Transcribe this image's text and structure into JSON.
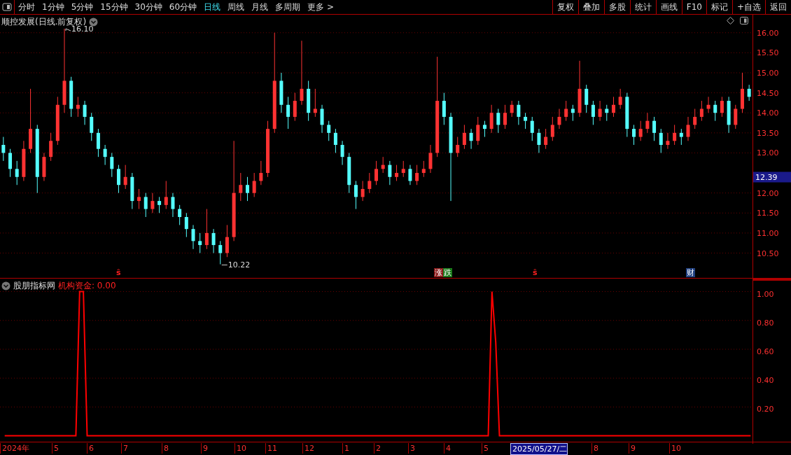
{
  "toolbar": {
    "tabs": [
      {
        "label": "分时",
        "selected": false
      },
      {
        "label": "1分钟",
        "selected": false
      },
      {
        "label": "5分钟",
        "selected": false
      },
      {
        "label": "15分钟",
        "selected": false
      },
      {
        "label": "30分钟",
        "selected": false
      },
      {
        "label": "60分钟",
        "selected": false
      },
      {
        "label": "日线",
        "selected": true
      },
      {
        "label": "周线",
        "selected": false
      },
      {
        "label": "月线",
        "selected": false
      },
      {
        "label": "多周期",
        "selected": false
      },
      {
        "label": "更多 >",
        "selected": false
      }
    ],
    "buttons": [
      "复权",
      "叠加",
      "多股",
      "统计",
      "画线",
      "F10",
      "标记",
      "+自选",
      "返回"
    ]
  },
  "main_chart": {
    "title": "顺控发展(日线.前复权)",
    "high_label": "16.10",
    "low_label": "10.22",
    "price_tag": "12.39",
    "markers": [
      {
        "kind": "symbol",
        "text": "ŝ"
      },
      {
        "kind": "badge",
        "text": "涨",
        "color": "#8b1a1a"
      },
      {
        "kind": "badge",
        "text": "跌",
        "color": "#1a7a1a"
      },
      {
        "kind": "symbol",
        "text": "ŝ"
      },
      {
        "kind": "badge",
        "text": "财",
        "color": "#1f3f7f"
      }
    ],
    "chart_data": {
      "type": "candlestick",
      "grid": true,
      "ylim": [
        9.88,
        16.45
      ],
      "yticks": [
        {
          "value": 16,
          "label": "16.00"
        },
        {
          "value": 15.5,
          "label": "15.50"
        },
        {
          "value": 15,
          "label": "15.00"
        },
        {
          "value": 14.5,
          "label": "14.50"
        },
        {
          "value": 14,
          "label": "14.00"
        },
        {
          "value": 13.5,
          "label": "13.50"
        },
        {
          "value": 13,
          "label": "13.00"
        },
        {
          "value": 12,
          "label": "12.00"
        },
        {
          "value": 11.5,
          "label": "11.50"
        },
        {
          "value": 11,
          "label": "11.00"
        },
        {
          "value": 10.5,
          "label": "10.50"
        }
      ],
      "categories": [
        null,
        null,
        null,
        null,
        null,
        null,
        null,
        null,
        null,
        null,
        null,
        null,
        null,
        null,
        null,
        null,
        null,
        null,
        null,
        null,
        null,
        null,
        null,
        null,
        null,
        null,
        null,
        null,
        null,
        null,
        null,
        null,
        null,
        null,
        null,
        null,
        null,
        null,
        null,
        null,
        null,
        null,
        null,
        null,
        null,
        null,
        null,
        null,
        null,
        null,
        null,
        null,
        null,
        null,
        null,
        null,
        null,
        null,
        null,
        null,
        null,
        null,
        null,
        null,
        null,
        null,
        null,
        null,
        null,
        null,
        null,
        null,
        null,
        null,
        null,
        null,
        null,
        null,
        null,
        null,
        null,
        null,
        null,
        null,
        null,
        null,
        null,
        null,
        null,
        null,
        null,
        null,
        null,
        null,
        null,
        null,
        null,
        null,
        null,
        null,
        null,
        null,
        null,
        null,
        null,
        null,
        null,
        null,
        null,
        null,
        null
      ],
      "ohlc": [
        [
          13.2,
          13.4,
          12.8,
          13.0
        ],
        [
          13.0,
          13.1,
          12.4,
          12.6
        ],
        [
          12.6,
          12.8,
          12.2,
          12.4
        ],
        [
          12.4,
          13.3,
          12.3,
          13.1
        ],
        [
          13.1,
          14.6,
          13.0,
          13.6
        ],
        [
          13.6,
          13.7,
          12.0,
          12.4
        ],
        [
          12.4,
          13.0,
          12.3,
          12.9
        ],
        [
          12.9,
          13.5,
          12.8,
          13.3
        ],
        [
          13.3,
          14.4,
          13.2,
          14.2
        ],
        [
          14.2,
          16.1,
          14.0,
          14.8
        ],
        [
          14.8,
          14.9,
          13.9,
          14.1
        ],
        [
          14.1,
          14.4,
          13.9,
          14.2
        ],
        [
          14.2,
          14.3,
          13.7,
          13.9
        ],
        [
          13.9,
          14.0,
          13.3,
          13.5
        ],
        [
          13.5,
          13.6,
          12.9,
          13.1
        ],
        [
          13.1,
          13.2,
          12.7,
          12.9
        ],
        [
          12.9,
          13.0,
          12.4,
          12.6
        ],
        [
          12.6,
          12.7,
          12.0,
          12.2
        ],
        [
          12.2,
          12.7,
          12.1,
          12.4
        ],
        [
          12.4,
          12.5,
          11.6,
          11.8
        ],
        [
          11.8,
          12.1,
          11.6,
          11.9
        ],
        [
          11.9,
          12.0,
          11.4,
          11.6
        ],
        [
          11.6,
          12.0,
          11.5,
          11.8
        ],
        [
          11.8,
          11.9,
          11.5,
          11.7
        ],
        [
          11.7,
          12.3,
          11.6,
          11.9
        ],
        [
          11.9,
          12.0,
          11.4,
          11.6
        ],
        [
          11.6,
          11.7,
          11.2,
          11.4
        ],
        [
          11.4,
          11.5,
          10.9,
          11.1
        ],
        [
          11.1,
          11.2,
          10.6,
          10.8
        ],
        [
          10.8,
          11.0,
          10.5,
          10.7
        ],
        [
          10.7,
          11.6,
          10.6,
          11.0
        ],
        [
          11.0,
          11.1,
          10.5,
          10.7
        ],
        [
          10.7,
          10.8,
          10.22,
          10.5
        ],
        [
          10.5,
          11.2,
          10.4,
          10.9
        ],
        [
          10.9,
          13.3,
          10.8,
          12.0
        ],
        [
          12.0,
          12.5,
          11.8,
          12.2
        ],
        [
          12.2,
          12.4,
          11.8,
          12.0
        ],
        [
          12.0,
          12.5,
          11.9,
          12.3
        ],
        [
          12.3,
          12.8,
          12.2,
          12.5
        ],
        [
          12.5,
          13.8,
          12.4,
          13.6
        ],
        [
          13.6,
          16.0,
          13.5,
          14.8
        ],
        [
          14.8,
          15.0,
          14.0,
          14.2
        ],
        [
          14.2,
          14.4,
          13.6,
          13.9
        ],
        [
          13.9,
          14.5,
          13.8,
          14.3
        ],
        [
          14.3,
          15.8,
          14.2,
          14.6
        ],
        [
          14.6,
          14.8,
          13.8,
          14.0
        ],
        [
          14.0,
          14.6,
          13.9,
          14.1
        ],
        [
          14.1,
          14.2,
          13.5,
          13.7
        ],
        [
          13.7,
          13.8,
          13.3,
          13.5
        ],
        [
          13.5,
          13.6,
          13.0,
          13.2
        ],
        [
          13.2,
          13.3,
          12.7,
          12.9
        ],
        [
          12.9,
          13.0,
          12.0,
          12.2
        ],
        [
          12.2,
          12.3,
          11.6,
          11.9
        ],
        [
          11.9,
          12.3,
          11.8,
          12.1
        ],
        [
          12.1,
          12.5,
          12.0,
          12.3
        ],
        [
          12.3,
          12.8,
          12.2,
          12.6
        ],
        [
          12.6,
          12.9,
          12.5,
          12.7
        ],
        [
          12.7,
          12.8,
          12.2,
          12.4
        ],
        [
          12.4,
          12.7,
          12.3,
          12.5
        ],
        [
          12.5,
          12.8,
          12.4,
          12.6
        ],
        [
          12.6,
          12.7,
          12.2,
          12.3
        ],
        [
          12.3,
          12.7,
          12.2,
          12.5
        ],
        [
          12.5,
          12.8,
          12.4,
          12.6
        ],
        [
          12.6,
          13.2,
          12.5,
          13.0
        ],
        [
          13.0,
          15.4,
          12.9,
          14.3
        ],
        [
          14.3,
          14.5,
          13.7,
          13.9
        ],
        [
          13.9,
          14.0,
          11.8,
          13.0
        ],
        [
          13.0,
          13.4,
          12.9,
          13.2
        ],
        [
          13.2,
          13.7,
          13.1,
          13.5
        ],
        [
          13.5,
          13.6,
          13.1,
          13.3
        ],
        [
          13.3,
          13.9,
          13.2,
          13.7
        ],
        [
          13.7,
          13.8,
          13.4,
          13.6
        ],
        [
          13.6,
          14.2,
          13.5,
          14.0
        ],
        [
          14.0,
          14.1,
          13.5,
          13.7
        ],
        [
          13.7,
          14.2,
          13.6,
          14.0
        ],
        [
          14.0,
          14.3,
          13.9,
          14.2
        ],
        [
          14.2,
          14.3,
          13.7,
          13.9
        ],
        [
          13.9,
          14.0,
          13.6,
          13.8
        ],
        [
          13.8,
          13.9,
          13.3,
          13.5
        ],
        [
          13.5,
          13.6,
          13.0,
          13.2
        ],
        [
          13.2,
          13.6,
          13.1,
          13.4
        ],
        [
          13.4,
          13.9,
          13.3,
          13.7
        ],
        [
          13.7,
          14.1,
          13.6,
          13.9
        ],
        [
          13.9,
          14.3,
          13.8,
          14.1
        ],
        [
          14.1,
          14.2,
          13.8,
          14.0
        ],
        [
          14.0,
          15.3,
          13.9,
          14.6
        ],
        [
          14.6,
          14.7,
          14.0,
          14.2
        ],
        [
          14.2,
          14.3,
          13.7,
          13.9
        ],
        [
          13.9,
          14.3,
          13.8,
          14.1
        ],
        [
          14.1,
          14.2,
          13.8,
          14.0
        ],
        [
          14.0,
          14.4,
          13.9,
          14.2
        ],
        [
          14.2,
          14.6,
          14.1,
          14.4
        ],
        [
          14.4,
          14.5,
          13.4,
          13.6
        ],
        [
          13.6,
          13.7,
          13.2,
          13.4
        ],
        [
          13.4,
          13.8,
          13.3,
          13.6
        ],
        [
          13.6,
          14.0,
          13.5,
          13.8
        ],
        [
          13.8,
          13.9,
          13.3,
          13.5
        ],
        [
          13.5,
          13.6,
          13.0,
          13.2
        ],
        [
          13.2,
          13.5,
          13.1,
          13.3
        ],
        [
          13.3,
          13.7,
          13.2,
          13.5
        ],
        [
          13.5,
          13.6,
          13.2,
          13.4
        ],
        [
          13.4,
          13.9,
          13.3,
          13.7
        ],
        [
          13.7,
          14.1,
          13.6,
          13.9
        ],
        [
          13.9,
          14.3,
          13.8,
          14.1
        ],
        [
          14.1,
          14.4,
          14.0,
          14.2
        ],
        [
          14.2,
          14.3,
          13.8,
          14.0
        ],
        [
          14.0,
          14.4,
          13.9,
          14.3
        ],
        [
          14.3,
          14.4,
          13.5,
          13.7
        ],
        [
          13.7,
          14.2,
          13.6,
          14.1
        ],
        [
          14.1,
          15.0,
          14.0,
          14.6
        ],
        [
          14.6,
          14.7,
          14.3,
          14.4
        ]
      ]
    }
  },
  "indicator": {
    "name": "股朋指标网",
    "reading": "机构资金: 0.00",
    "chart_data": {
      "type": "line",
      "grid": true,
      "categories": [
        null,
        null,
        null,
        null,
        null,
        null,
        null,
        null,
        null,
        null,
        null,
        null,
        null,
        null,
        null,
        null,
        null,
        null,
        null,
        null,
        null,
        null,
        null,
        null,
        null,
        null,
        null,
        null,
        null,
        null,
        null,
        null,
        null,
        null,
        null,
        null,
        null,
        null,
        null,
        null,
        null,
        null,
        null,
        null,
        null,
        null,
        null,
        null,
        null,
        null,
        null,
        null,
        null,
        null,
        null,
        null,
        null,
        null,
        null,
        null,
        null,
        null,
        null,
        null,
        null,
        null,
        null,
        null,
        null,
        null,
        null,
        null,
        null,
        null,
        null,
        null,
        null,
        null,
        null,
        null,
        null,
        null,
        null,
        null,
        null,
        null,
        null,
        null,
        null,
        null,
        null,
        null,
        null,
        null,
        null,
        null,
        null,
        null,
        null,
        null,
        null,
        null,
        null,
        null,
        null,
        null,
        null,
        null,
        null,
        null,
        null,
        null,
        null,
        null,
        null,
        null,
        null,
        null,
        null,
        null,
        null,
        null,
        null,
        null,
        null,
        null,
        null,
        null,
        null,
        null,
        null,
        null,
        null,
        null,
        null,
        null,
        null,
        null,
        null,
        null,
        null,
        null,
        null,
        null,
        null,
        null,
        null,
        null,
        null,
        null,
        null,
        null,
        null,
        null,
        null,
        null,
        null,
        null,
        null,
        null,
        null,
        null,
        null,
        null,
        null,
        null,
        null,
        null,
        null,
        null,
        null,
        null,
        null,
        null,
        null,
        null,
        null,
        null,
        null,
        null,
        null,
        null,
        null,
        null,
        null,
        null,
        null,
        null,
        null,
        null,
        null,
        null,
        null,
        null,
        null,
        null,
        null,
        null,
        null,
        null
      ],
      "ylim": [
        -0.06,
        1.09
      ],
      "yticks": [
        {
          "value": 1,
          "label": "1.00"
        },
        {
          "value": 0.8,
          "label": "0.80"
        },
        {
          "value": 0.6,
          "label": "0.60"
        },
        {
          "value": 0.4,
          "label": "0.40"
        },
        {
          "value": 0.2,
          "label": "0.20"
        }
      ],
      "series": [
        {
          "color": "#ff0000",
          "values": [
            0,
            0,
            0,
            0,
            0,
            0,
            0,
            0,
            0,
            0,
            0,
            0,
            0,
            0,
            0,
            0,
            0,
            0,
            0,
            0,
            1,
            1,
            0,
            0,
            0,
            0,
            0,
            0,
            0,
            0,
            0,
            0,
            0,
            0,
            0,
            0,
            0,
            0,
            0,
            0,
            0,
            0,
            0,
            0,
            0,
            0,
            0,
            0,
            0,
            0,
            0,
            0,
            0,
            0,
            0,
            0,
            0,
            0,
            0,
            0,
            0,
            0,
            0,
            0,
            0,
            0,
            0,
            0,
            0,
            0,
            0,
            0,
            0,
            0,
            0,
            0,
            0,
            0,
            0,
            0,
            0,
            0,
            0,
            0,
            0,
            0,
            0,
            0,
            0,
            0,
            0,
            0,
            0,
            0,
            0,
            0,
            0,
            0,
            0,
            0,
            0,
            0,
            0,
            0,
            0,
            0,
            0,
            0,
            0,
            0,
            0,
            0,
            0,
            0,
            0,
            0,
            0,
            0,
            0,
            0,
            0,
            0,
            0,
            0,
            0,
            0,
            0,
            0,
            0,
            0,
            1,
            0.65,
            0,
            0,
            0,
            0,
            0,
            0,
            0,
            0,
            0,
            0,
            0,
            0,
            0,
            0,
            0,
            0,
            0,
            0,
            0,
            0,
            0,
            0,
            0,
            0,
            0,
            0,
            0,
            0,
            0,
            0,
            0,
            0,
            0,
            0,
            0,
            0,
            0,
            0,
            0,
            0,
            0,
            0,
            0,
            0,
            0,
            0,
            0,
            0,
            0,
            0,
            0,
            0,
            0,
            0,
            0,
            0,
            0,
            0,
            0,
            0,
            0,
            0,
            0,
            0,
            0,
            0,
            0,
            0
          ]
        }
      ]
    }
  },
  "time_axis": {
    "labels": [
      {
        "text": "2024年",
        "selected": false
      },
      {
        "text": "5",
        "selected": false
      },
      {
        "text": "6",
        "selected": false
      },
      {
        "text": "7",
        "selected": false
      },
      {
        "text": "8",
        "selected": false
      },
      {
        "text": "9",
        "selected": false
      },
      {
        "text": "10",
        "selected": false
      },
      {
        "text": "11",
        "selected": false
      },
      {
        "text": "12",
        "selected": false
      },
      {
        "text": "1",
        "selected": false
      },
      {
        "text": "2",
        "selected": false
      },
      {
        "text": "3",
        "selected": false
      },
      {
        "text": "4",
        "selected": false
      },
      {
        "text": "5",
        "selected": false
      },
      {
        "text": "2025/05/27/二",
        "selected": true
      },
      {
        "text": "8",
        "selected": false
      },
      {
        "text": "9",
        "selected": false
      },
      {
        "text": "10",
        "selected": false
      }
    ]
  }
}
